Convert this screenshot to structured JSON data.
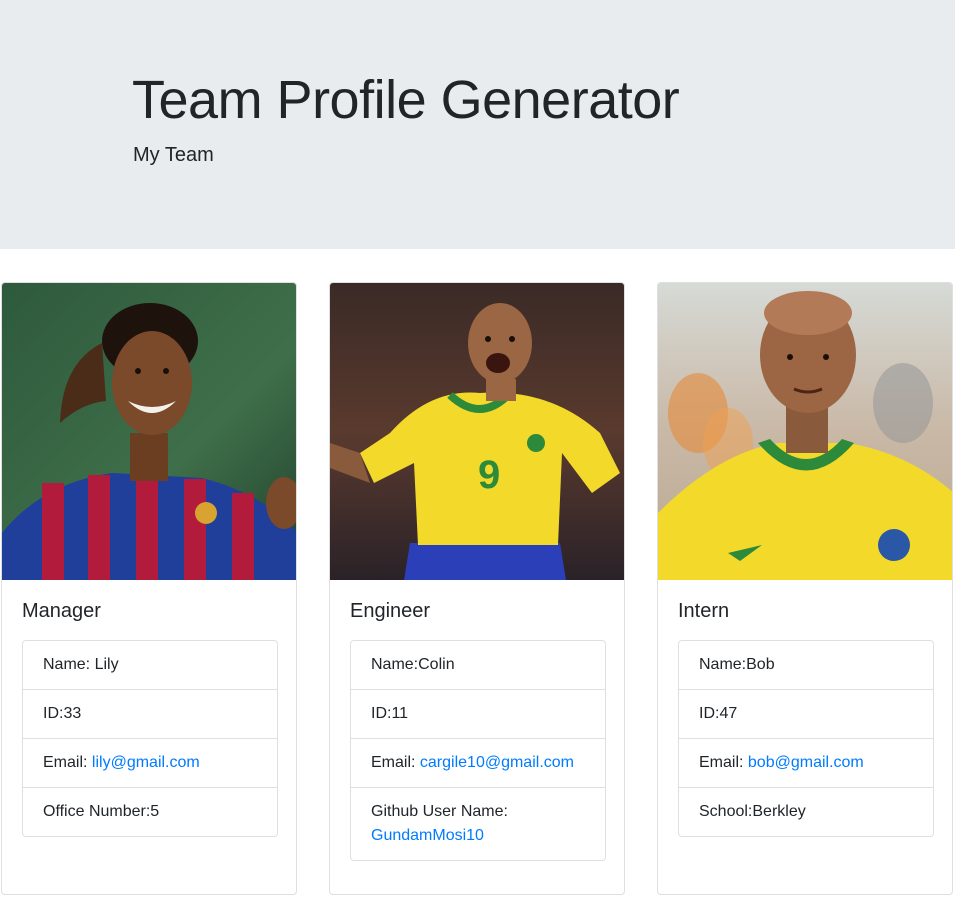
{
  "header": {
    "title": "Team Profile Generator",
    "subtitle": "My Team"
  },
  "colors": {
    "jumbotron_bg": "#e9ecef",
    "link": "#007bff",
    "text": "#212529"
  },
  "cards": [
    {
      "role": "Manager",
      "photo": "photo-manager",
      "name_text": "Name: Lily",
      "id_text": "ID:33",
      "email_label": "Email: ",
      "email": "lily@gmail.com",
      "extra_text": "Office Number:5"
    },
    {
      "role": "Engineer",
      "photo": "photo-engineer",
      "name_text": "Name:Colin",
      "id_text": "ID:11",
      "email_label": "Email: ",
      "email": "cargile10@gmail.com",
      "extra_label": "Github User Name:",
      "extra_link": "GundamMosi10"
    },
    {
      "role": "Intern",
      "photo": "photo-intern",
      "name_text": "Name:Bob",
      "id_text": "ID:47",
      "email_label": "Email: ",
      "email": "bob@gmail.com",
      "extra_text": "School:Berkley"
    }
  ]
}
